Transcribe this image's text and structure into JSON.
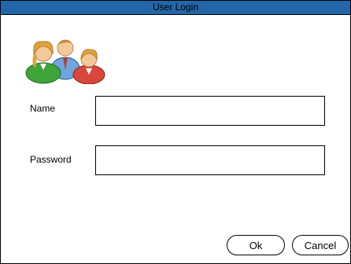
{
  "window": {
    "title": "User Login"
  },
  "icon": "users-group-icon",
  "form": {
    "name_label": "Name",
    "name_value": "",
    "password_label": "Password",
    "password_value": ""
  },
  "buttons": {
    "ok_label": "Ok",
    "cancel_label": "Cancel"
  },
  "colors": {
    "titlebar": "#2366a8",
    "border": "#000000",
    "background": "#ffffff"
  }
}
